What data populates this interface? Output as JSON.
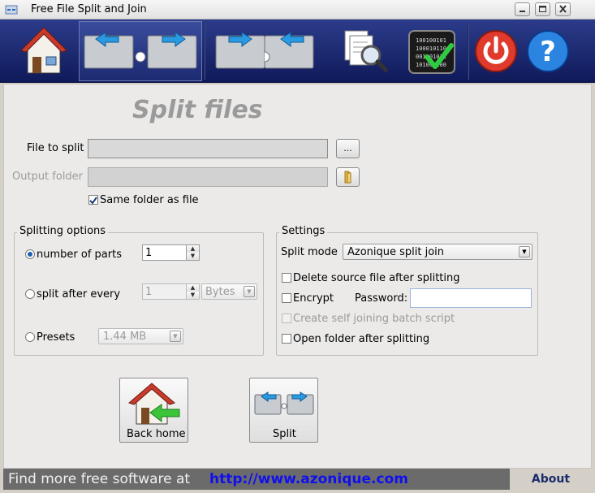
{
  "window": {
    "title": "Free File Split and Join"
  },
  "toolbar": {
    "items": [
      {
        "name": "home",
        "icon": "home-icon"
      },
      {
        "name": "split",
        "icon": "split-arrows-icon",
        "active": true
      },
      {
        "name": "join",
        "icon": "join-arrows-icon"
      },
      {
        "name": "search",
        "icon": "magnifier-icon"
      },
      {
        "name": "checksum",
        "icon": "binary-check-icon"
      },
      {
        "name": "exit",
        "icon": "power-icon"
      },
      {
        "name": "help",
        "icon": "help-icon"
      }
    ]
  },
  "page": {
    "title": "Split files"
  },
  "form": {
    "file_label": "File to split",
    "file_value": "",
    "browse_label": "...",
    "output_label": "Output folder",
    "output_value": "",
    "same_folder_label": "Same folder as  file",
    "same_folder_checked": true
  },
  "splitting": {
    "title": "Splitting options",
    "parts_label": "number of parts",
    "parts_value": "1",
    "after_label": "split after every",
    "after_value": "1",
    "after_unit": "Bytes",
    "presets_label": "Presets",
    "presets_value": "1.44 MB",
    "selected": "parts"
  },
  "settings": {
    "title": "Settings",
    "mode_label": "Split mode",
    "mode_value": "Azonique split join",
    "delete_label": "Delete source file after splitting",
    "encrypt_label": "Encrypt",
    "password_label": "Password:",
    "password_value": "",
    "batch_label": "Create self joining batch script",
    "open_folder_label": "Open folder after splitting"
  },
  "actions": {
    "back_label": "Back home",
    "split_label": "Split"
  },
  "footer": {
    "text": "Find more free software at",
    "link": "http://www.azonique.com",
    "about_label": "About"
  },
  "colors": {
    "toolbar": "#1c2a72",
    "title_gray": "#9a9a9a",
    "link_blue": "#1010ee",
    "footer": "#6b6b6b"
  }
}
